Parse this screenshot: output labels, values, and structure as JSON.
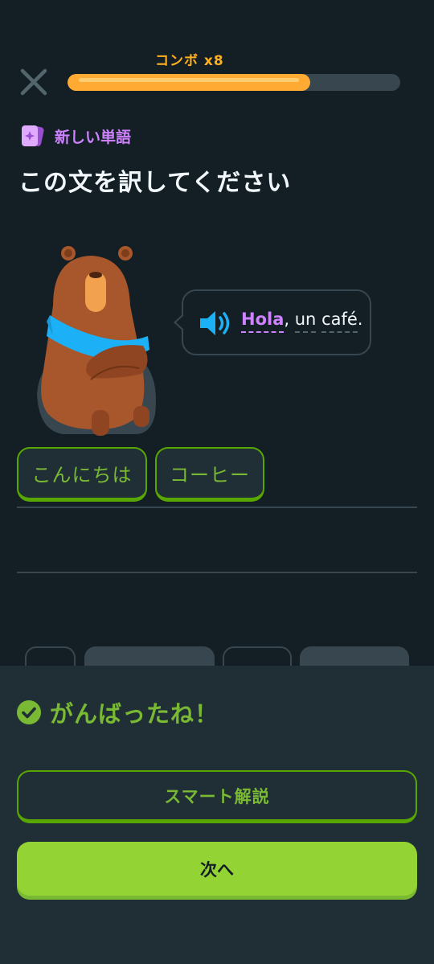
{
  "header": {
    "combo_label": "コンボ x8",
    "progress_fraction": 0.73,
    "colors": {
      "progress": "#ffab33",
      "track": "#37464f"
    }
  },
  "challenge": {
    "badge_label": "新しい単語",
    "title": "この文を訳してください",
    "sentence": {
      "word_new": "Hola",
      "sep": ",",
      "word2": "un",
      "word3": "café",
      "end": "."
    }
  },
  "answer_chips": [
    "こんにちは",
    "コーヒー"
  ],
  "feedback": {
    "result_text": "がんばったね！",
    "explain_button": "スマート解説",
    "next_button": "次へ"
  },
  "icons": {
    "close": "close-icon",
    "badge": "new-word-card-icon",
    "speaker": "speaker-icon",
    "check": "check-circle-icon"
  },
  "colors": {
    "background": "#131f24",
    "accent_green": "#93d333",
    "accent_purple": "#ce82ff",
    "accent_orange": "#ffab33"
  }
}
